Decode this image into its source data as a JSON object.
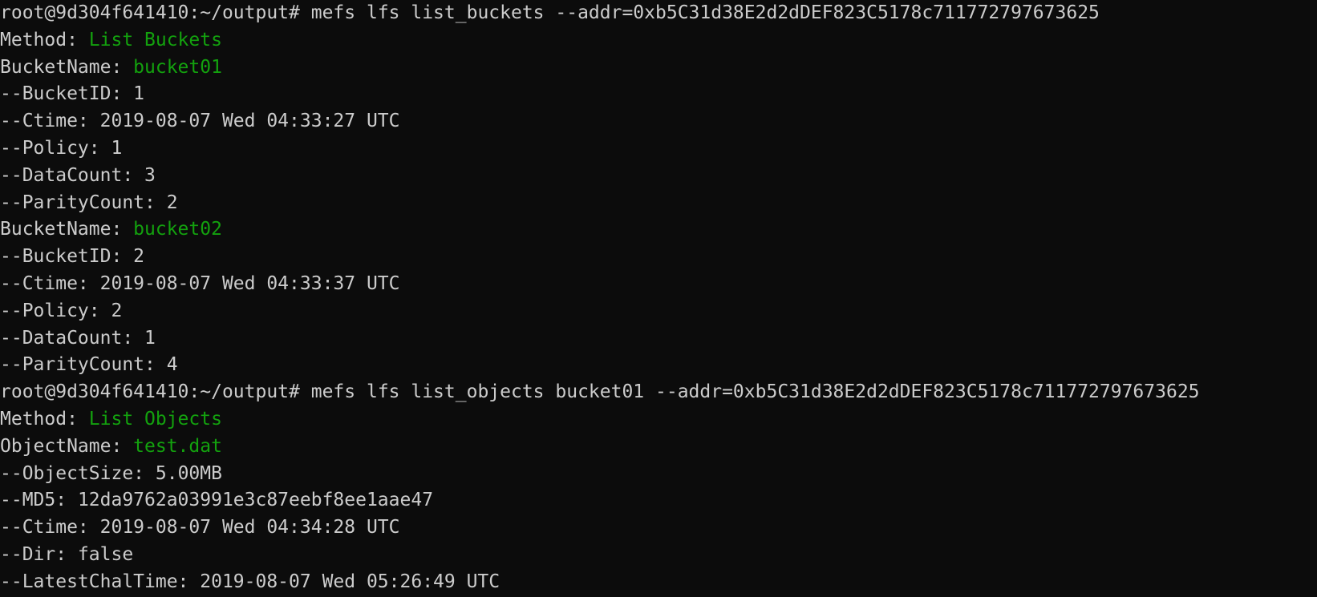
{
  "colors": {
    "background": "#0c0c0c",
    "foreground": "#cccccc",
    "highlight": "#13a10e"
  },
  "lines": [
    {
      "kind": "prompt",
      "prompt": "root@9d304f641410:~/output# ",
      "command": "mefs lfs list_buckets --addr=0xb5C31d38E2d2dDEF823C5178c711772797673625"
    },
    {
      "kind": "field",
      "label": "Method: ",
      "value": "List Buckets",
      "green": true
    },
    {
      "kind": "field",
      "label": "BucketName: ",
      "value": "bucket01",
      "green": true
    },
    {
      "kind": "field",
      "label": "--BucketID: ",
      "value": "1",
      "green": false
    },
    {
      "kind": "field",
      "label": "--Ctime: ",
      "value": "2019-08-07 Wed 04:33:27 UTC",
      "green": false
    },
    {
      "kind": "field",
      "label": "--Policy: ",
      "value": "1",
      "green": false
    },
    {
      "kind": "field",
      "label": "--DataCount: ",
      "value": "3",
      "green": false
    },
    {
      "kind": "field",
      "label": "--ParityCount: ",
      "value": "2",
      "green": false
    },
    {
      "kind": "field",
      "label": "BucketName: ",
      "value": "bucket02",
      "green": true
    },
    {
      "kind": "field",
      "label": "--BucketID: ",
      "value": "2",
      "green": false
    },
    {
      "kind": "field",
      "label": "--Ctime: ",
      "value": "2019-08-07 Wed 04:33:37 UTC",
      "green": false
    },
    {
      "kind": "field",
      "label": "--Policy: ",
      "value": "2",
      "green": false
    },
    {
      "kind": "field",
      "label": "--DataCount: ",
      "value": "1",
      "green": false
    },
    {
      "kind": "field",
      "label": "--ParityCount: ",
      "value": "4",
      "green": false
    },
    {
      "kind": "prompt",
      "prompt": "root@9d304f641410:~/output# ",
      "command": "mefs lfs list_objects bucket01 --addr=0xb5C31d38E2d2dDEF823C5178c711772797673625"
    },
    {
      "kind": "field",
      "label": "Method: ",
      "value": "List Objects",
      "green": true
    },
    {
      "kind": "field",
      "label": "ObjectName: ",
      "value": "test.dat",
      "green": true
    },
    {
      "kind": "field",
      "label": "--ObjectSize: ",
      "value": "5.00MB",
      "green": false
    },
    {
      "kind": "field",
      "label": "--MD5: ",
      "value": "12da9762a03991e3c87eebf8ee1aae47",
      "green": false
    },
    {
      "kind": "field",
      "label": "--Ctime: ",
      "value": "2019-08-07 Wed 04:34:28 UTC",
      "green": false
    },
    {
      "kind": "field",
      "label": "--Dir: ",
      "value": "false",
      "green": false
    },
    {
      "kind": "field",
      "label": "--LatestChalTime: ",
      "value": "2019-08-07 Wed 05:26:49 UTC",
      "green": false
    }
  ]
}
